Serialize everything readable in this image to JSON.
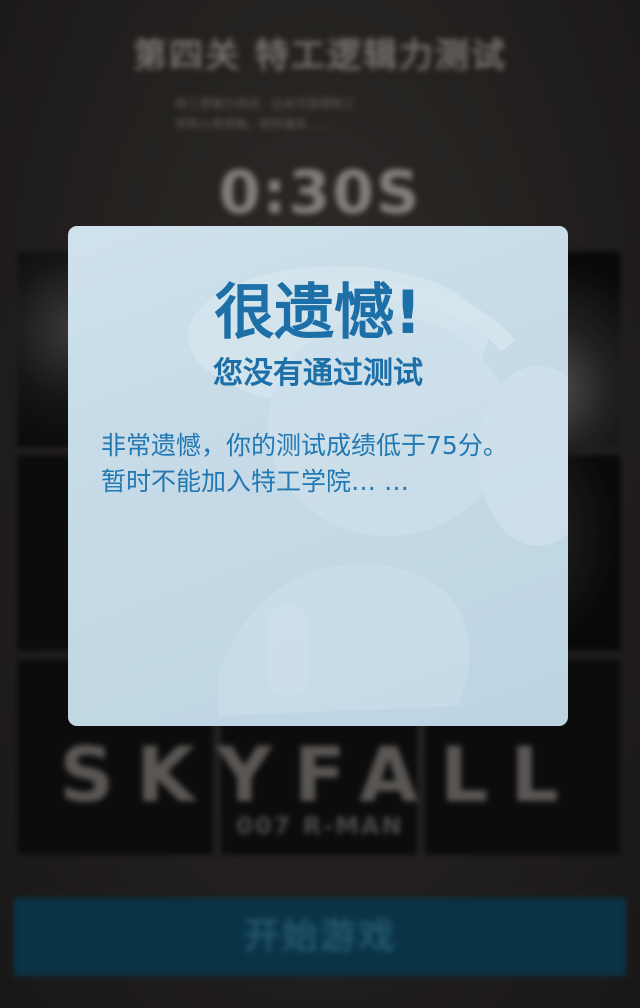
{
  "background": {
    "level_title": "第四关  特工逻辑力测试",
    "description": [
      "特工逻辑力测试，过关可获得特工",
      "学院入场资格，祝你通关……"
    ],
    "timer": "0:30S",
    "logo_main": "SKYFALL",
    "logo_sub": "007 R-MAN",
    "start_button_label": "开始游戏"
  },
  "modal": {
    "title": "很遗憾!",
    "subtitle": "您没有通过测试",
    "message_lines": [
      "非常遗憾，你的测试成绩低于75分。",
      "暂时不能加入特工学院… …"
    ]
  },
  "colors": {
    "modal_text": "#1d6fa7",
    "modal_bg": "#c9dde8",
    "start_button_bg": "#0d3f56"
  }
}
